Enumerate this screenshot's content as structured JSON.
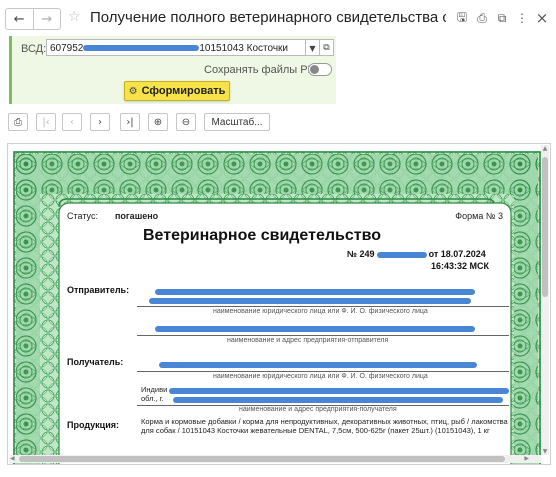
{
  "window": {
    "title": "Получение полного ветеринарного свидетельства с рас…",
    "nav": {
      "back_icon": "←",
      "forward_icon": "→"
    },
    "favorite_icon": "☆",
    "actions": {
      "save_icon": "🖫",
      "print_icon": "⎙",
      "more_icon": "⋮",
      "close_icon": "×",
      "link_icon": "⧉"
    }
  },
  "form": {
    "vsd_label": "ВСД:",
    "vsd_value_start": "607952",
    "vsd_value_end": "10151043 Косточки",
    "save_pdf_label": "Сохранять файлы PDF:",
    "save_pdf_on": false,
    "generate_button": "Сформировать"
  },
  "toolbar": {
    "print_icon": "⎙",
    "first_icon": "|‹",
    "prev_icon": "‹",
    "next_icon": "›",
    "last_icon": "›|",
    "zoom_in_icon": "⊕",
    "zoom_out_icon": "⊖",
    "scale_button": "Масштаб..."
  },
  "certificate": {
    "status_label": "Статус:",
    "status_value": "погашено",
    "form_number": "Форма № 3",
    "title": "Ветеринарное свидетельство",
    "number_prefix": "№ 249",
    "number_suffix": "от 18.07.2024",
    "time": "16:43:32 МСК",
    "sender_label": "Отправитель:",
    "caption_legal_name": "наименование юридического лица или Ф. И. О. физического лица",
    "caption_sender_enterprise": "наименование и адрес предприятия-отправителя",
    "recipient_label": "Получатель:",
    "recipient_prefix": "Индиви",
    "recipient_region": "обл., г.",
    "caption_recipient_enterprise": "наименование и адрес предприятия-получателя",
    "product_label": "Продукция:",
    "product_text": "Корма и кормовые добавки / корма для непродуктивных, декоративных животных, птиц, рыб / лакомства для собак / 10151043 Косточки жевательные DENTAL, 7,5см, 500-625г (пакет 25шт.) (10151043), 1 кг"
  },
  "colors": {
    "accent_green": "#7cbf5a",
    "panel_bg": "#eef8e4",
    "button_yellow": "#f7e24a",
    "redaction_blue": "#4a86d6",
    "ornament_green": "#3a9a4e"
  }
}
